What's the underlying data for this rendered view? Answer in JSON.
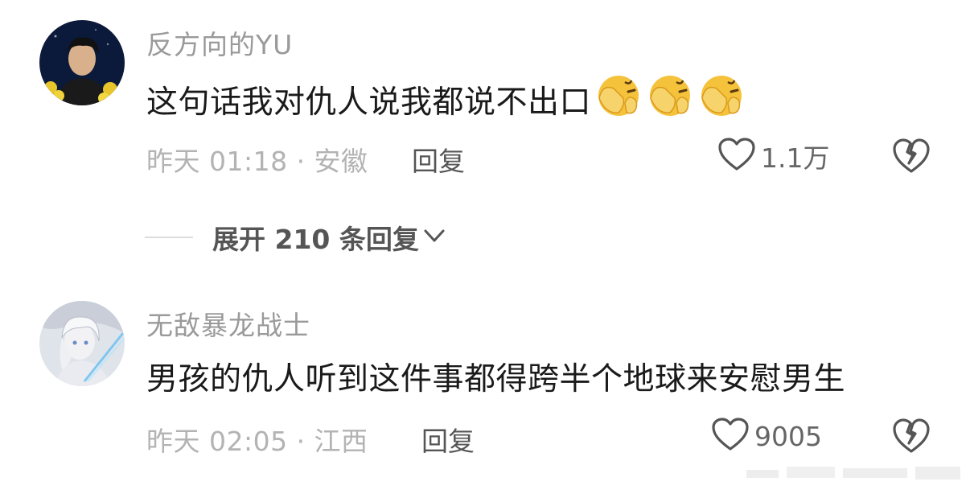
{
  "comments": [
    {
      "username": "反方向的YU",
      "text": "这句话我对仇人说我都说不出口",
      "emoji": [
        "face-hand-over-eyes",
        "face-hand-over-eyes",
        "face-hand-over-eyes"
      ],
      "time_location": "昨天 01:18 · 安徽",
      "reply_label": "回复",
      "likes": "1.1万"
    },
    {
      "username": "无敌暴龙战士",
      "text": "男孩的仇人听到这件事都得跨半个地球来安慰男生",
      "time_location": "昨天 02:05 · 江西",
      "reply_label": "回复",
      "likes": "9005"
    }
  ],
  "expand_replies": {
    "label": "展开 210 条回复"
  },
  "icons": {
    "like": "heart-outline-icon",
    "dislike": "broken-heart-icon",
    "expand": "chevron-down-icon"
  },
  "colors": {
    "username": "#9a9a9a",
    "body": "#1a1a1a",
    "meta": "#b3b3b3",
    "emoji": "#f5c23c"
  }
}
